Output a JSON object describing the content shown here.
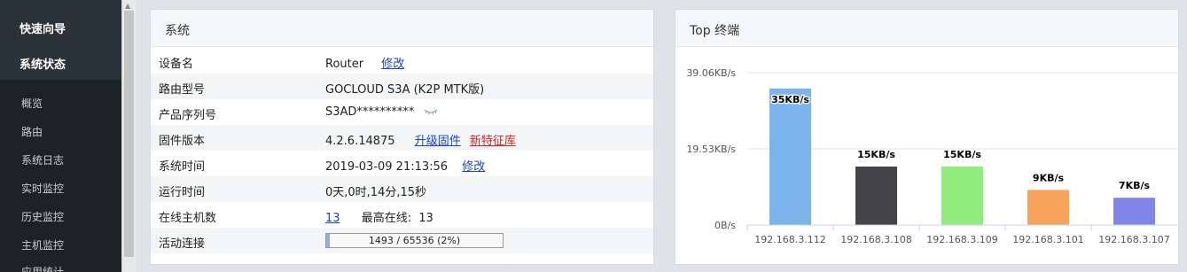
{
  "sidebar": {
    "top_items": [
      "快速向导",
      "系统状态"
    ],
    "sub_items": [
      "概览",
      "路由",
      "系统日志",
      "实时监控",
      "历史监控",
      "主机监控",
      "应用统计"
    ]
  },
  "system_panel": {
    "title": "系统",
    "rows": {
      "device_name": {
        "label": "设备名",
        "value": "Router",
        "link": "修改"
      },
      "model": {
        "label": "路由型号",
        "value": "GOCLOUD S3A (K2P MTK版)"
      },
      "serial": {
        "label": "产品序列号",
        "value": "S3AD**********"
      },
      "firmware": {
        "label": "固件版本",
        "value": "4.2.6.14875",
        "link1": "升级固件",
        "link2": "新特征库"
      },
      "time": {
        "label": "系统时间",
        "value": "2019-03-09 21:13:56",
        "link": "修改"
      },
      "uptime": {
        "label": "运行时间",
        "value": "0天,0时,14分,15秒"
      },
      "hosts": {
        "label": "在线主机数",
        "value": "13",
        "max_label": "最高在线:",
        "max_value": "13"
      },
      "connections": {
        "label": "活动连接",
        "text": "1493 / 65536 (2%)",
        "fraction": 0.02
      }
    }
  },
  "top_panel": {
    "title": "Top 终端"
  },
  "chart_data": {
    "type": "bar",
    "title": "",
    "y_ticks": [
      "39.06KB/s",
      "19.53KB/s",
      "0B/s"
    ],
    "ylim": [
      0,
      39.06
    ],
    "categories": [
      "192.168.3.112",
      "192.168.3.108",
      "192.168.3.109",
      "192.168.3.101",
      "192.168.3.107"
    ],
    "values": [
      35,
      15,
      15,
      9,
      7
    ],
    "labels": [
      "35KB/s",
      "15KB/s",
      "15KB/s",
      "9KB/s",
      "7KB/s"
    ],
    "colors": [
      "#7cb5ec",
      "#434348",
      "#90ed7d",
      "#f7a35c",
      "#8085e9"
    ]
  }
}
